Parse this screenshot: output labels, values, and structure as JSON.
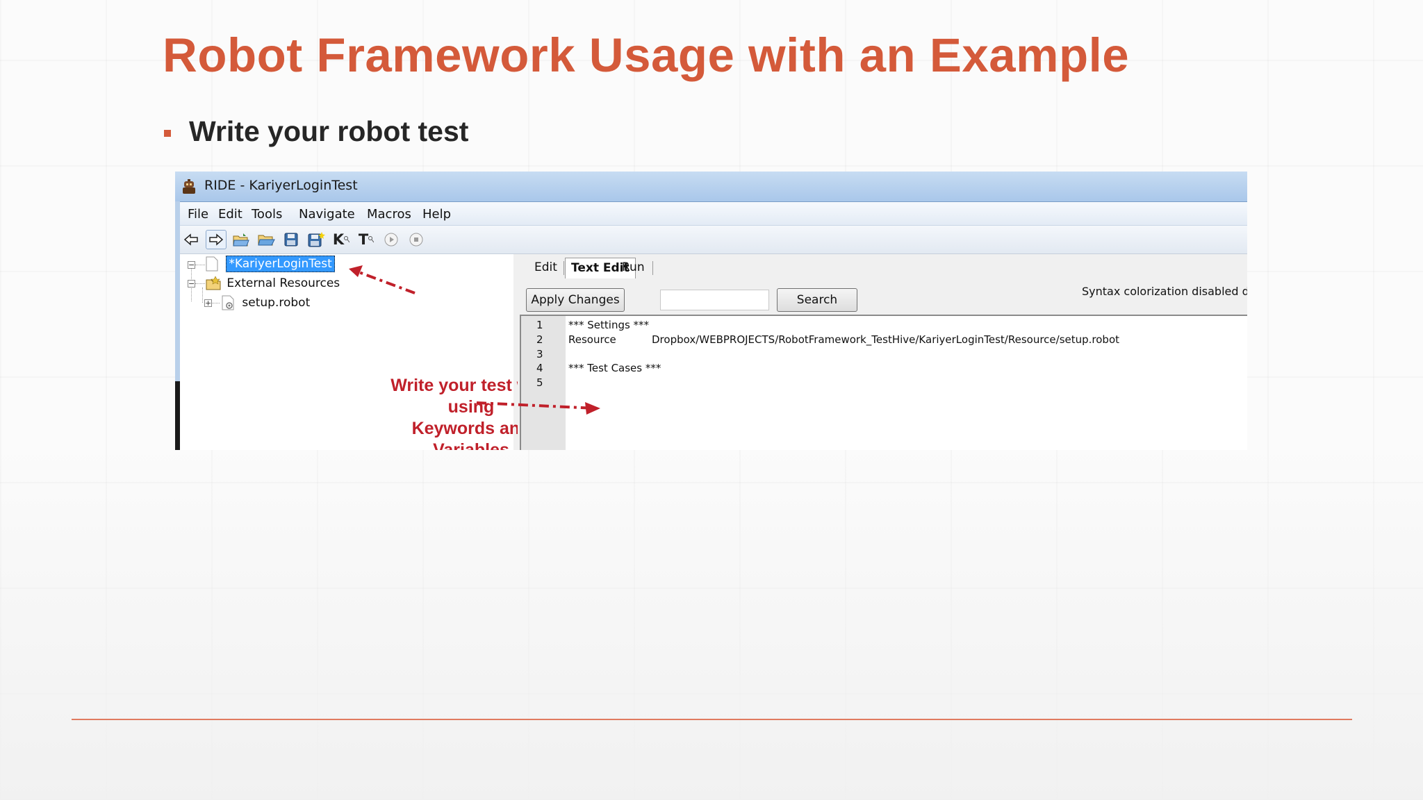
{
  "slide": {
    "title": "Robot Framework Usage with an Example",
    "bullet": "Write your robot test"
  },
  "window": {
    "title": "RIDE - KariyerLoginTest"
  },
  "menu": [
    "File",
    "Edit",
    "Tools",
    "Navigate",
    "Macros",
    "Help"
  ],
  "toolbar": {
    "icons": [
      "back-arrow-icon",
      "forward-arrow-icon",
      "open-directory-icon",
      "open-folder-icon",
      "save-icon",
      "save-all-icon",
      "keyword-search-icon",
      "test-search-icon",
      "run-icon",
      "stop-icon"
    ],
    "k_label": "K",
    "t_label": "T"
  },
  "tree": {
    "root": "*KariyerLoginTest",
    "external": "External Resources",
    "resource": "setup.robot",
    "toggle_minus": "−",
    "toggle_plus": "+"
  },
  "annotation": {
    "line1": "Write your test with using",
    "line2": "Keywords and Variables"
  },
  "editor": {
    "tabs": [
      "Edit",
      "Text Edit",
      "Run"
    ],
    "active_tab": "Text Edit",
    "apply_label": "Apply Changes",
    "search_label": "Search",
    "search_value": "",
    "syntax_note": "Syntax colorization disabled due",
    "lines": [
      {
        "num": "1",
        "text": "*** Settings ***",
        "value": ""
      },
      {
        "num": "2",
        "text": "Resource",
        "value": "Dropbox/WEBPROJECTS/RobotFramework_TestHive/KariyerLoginTest/Resource/setup.robot"
      },
      {
        "num": "3",
        "text": "",
        "value": ""
      },
      {
        "num": "4",
        "text": "*** Test Cases ***",
        "value": ""
      },
      {
        "num": "5",
        "text": "",
        "value": ""
      }
    ]
  },
  "colors": {
    "accent": "#d45a3a",
    "annotation": "#c0202a",
    "selection": "#3399ff"
  }
}
